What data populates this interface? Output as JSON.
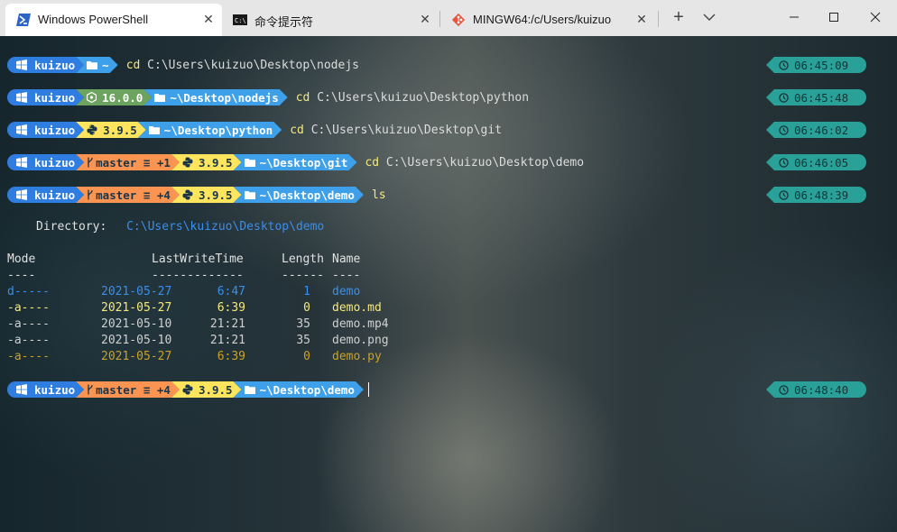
{
  "tabs": [
    {
      "title": "Windows PowerShell",
      "active": true,
      "icon": "powershell-icon"
    },
    {
      "title": "命令提示符",
      "active": false,
      "icon": "cmd-icon"
    },
    {
      "title": "MINGW64:/c/Users/kuizuo",
      "active": false,
      "icon": "git-icon"
    }
  ],
  "window_controls": {
    "minimize": "minimize-icon",
    "maximize": "maximize-icon",
    "close": "close-icon"
  },
  "colors": {
    "user": "#2f7de1",
    "node": "#6ca35e",
    "git": "#fb9450",
    "python": "#ffe45e",
    "path": "#3ea0e8",
    "time": "#2aa198",
    "dir": "#3b8eea",
    "md": "#f5e87a",
    "py": "#c9a227"
  },
  "prompts": [
    {
      "user": "kuizuo",
      "path": "~",
      "cmd_kw": "cd",
      "cmd_arg": "C:\\Users\\kuizuo\\Desktop\\nodejs",
      "time": "06:45:09"
    },
    {
      "user": "kuizuo",
      "node": "16.0.0",
      "path": "~\\Desktop\\nodejs",
      "cmd_kw": "cd",
      "cmd_arg": "C:\\Users\\kuizuo\\Desktop\\python",
      "time": "06:45:48"
    },
    {
      "user": "kuizuo",
      "python": "3.9.5",
      "path": "~\\Desktop\\python",
      "cmd_kw": "cd",
      "cmd_arg": "C:\\Users\\kuizuo\\Desktop\\git",
      "time": "06:46:02"
    },
    {
      "user": "kuizuo",
      "git": "master ≡ +1",
      "python": "3.9.5",
      "path": "~\\Desktop\\git",
      "cmd_kw": "cd",
      "cmd_arg": "C:\\Users\\kuizuo\\Desktop\\demo",
      "time": "06:46:05"
    },
    {
      "user": "kuizuo",
      "git": "master ≡ +4",
      "python": "3.9.5",
      "path": "~\\Desktop\\demo",
      "cmd_kw": "ls",
      "cmd_arg": "",
      "time": "06:48:39"
    },
    {
      "user": "kuizuo",
      "git": "master ≡ +4",
      "python": "3.9.5",
      "path": "~\\Desktop\\demo",
      "cmd_kw": "",
      "cmd_arg": "",
      "time": "06:48:40"
    }
  ],
  "listing": {
    "directory_label": "Directory:",
    "directory_path": "C:\\Users\\kuizuo\\Desktop\\demo",
    "headers": {
      "mode": "Mode",
      "time": "LastWriteTime",
      "length": "Length",
      "name": "Name"
    },
    "rules": {
      "mode": "----",
      "time": "-------------",
      "length": "------",
      "name": "----"
    },
    "rows": [
      {
        "mode": "d-----",
        "date": "2021-05-27",
        "time": "6:47",
        "length": "1",
        "name": "demo"
      },
      {
        "mode": "-a----",
        "date": "2021-05-27",
        "time": "6:39",
        "length": "0",
        "name": "demo.md"
      },
      {
        "mode": "-a----",
        "date": "2021-05-10",
        "time": "21:21",
        "length": "35",
        "name": "demo.mp4"
      },
      {
        "mode": "-a----",
        "date": "2021-05-10",
        "time": "21:21",
        "length": "35",
        "name": "demo.png"
      },
      {
        "mode": "-a----",
        "date": "2021-05-27",
        "time": "6:39",
        "length": "0",
        "name": "demo.py"
      }
    ]
  }
}
